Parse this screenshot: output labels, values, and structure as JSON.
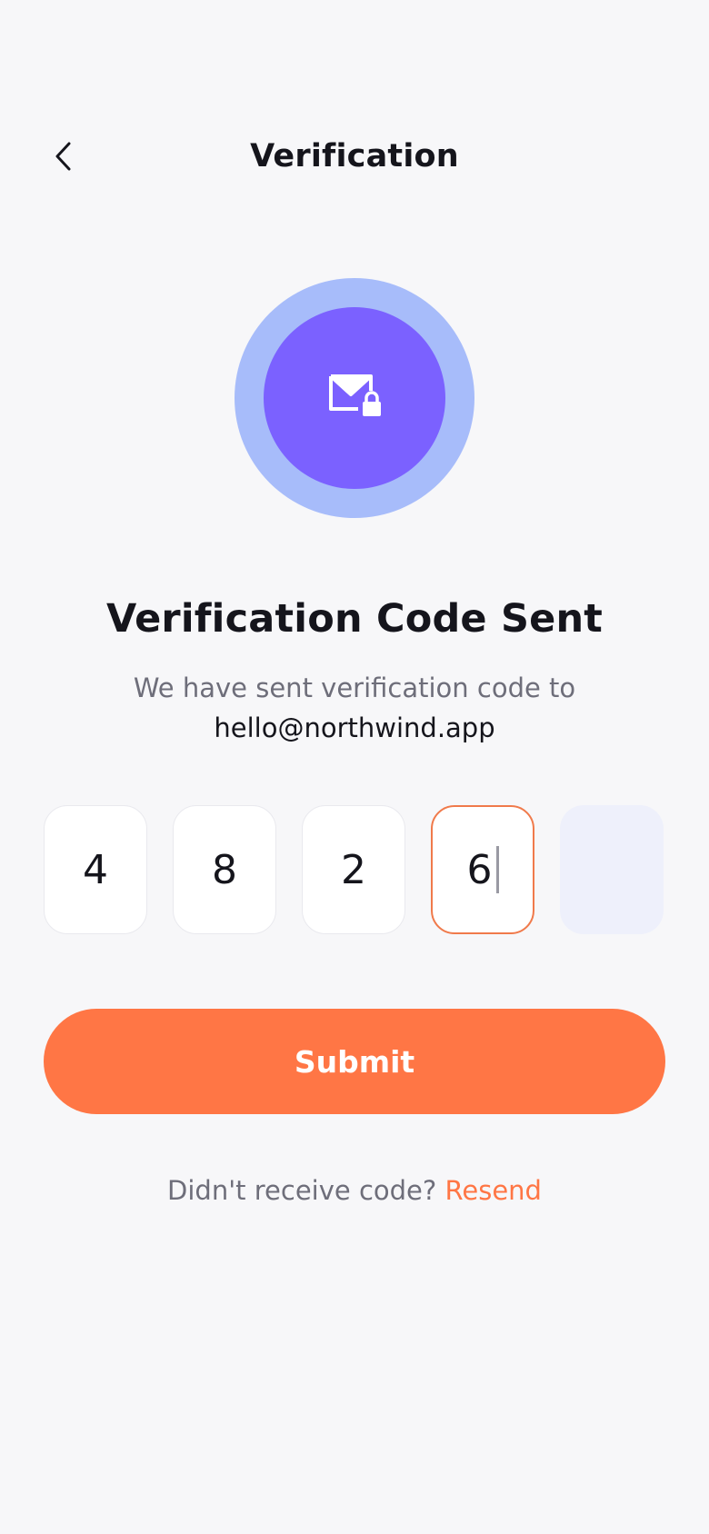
{
  "header": {
    "title": "Verification",
    "back_icon": "chevron-left-icon"
  },
  "hero": {
    "icon": "mail-lock-icon",
    "outer_color": "#A7BCFA",
    "inner_color": "#7B61FF"
  },
  "content": {
    "heading": "Verification Code Sent",
    "subtitle": "We have sent verification code to",
    "email": "hello@northwind.app"
  },
  "code": {
    "digits": [
      "4",
      "8",
      "2",
      "6",
      ""
    ],
    "active_index": 3
  },
  "actions": {
    "submit_label": "Submit",
    "resend_prompt": "Didn't receive code?",
    "resend_label": "Resend"
  },
  "colors": {
    "accent": "#FF7645",
    "background": "#F7F7F9",
    "empty_box": "#EEF0FB"
  }
}
